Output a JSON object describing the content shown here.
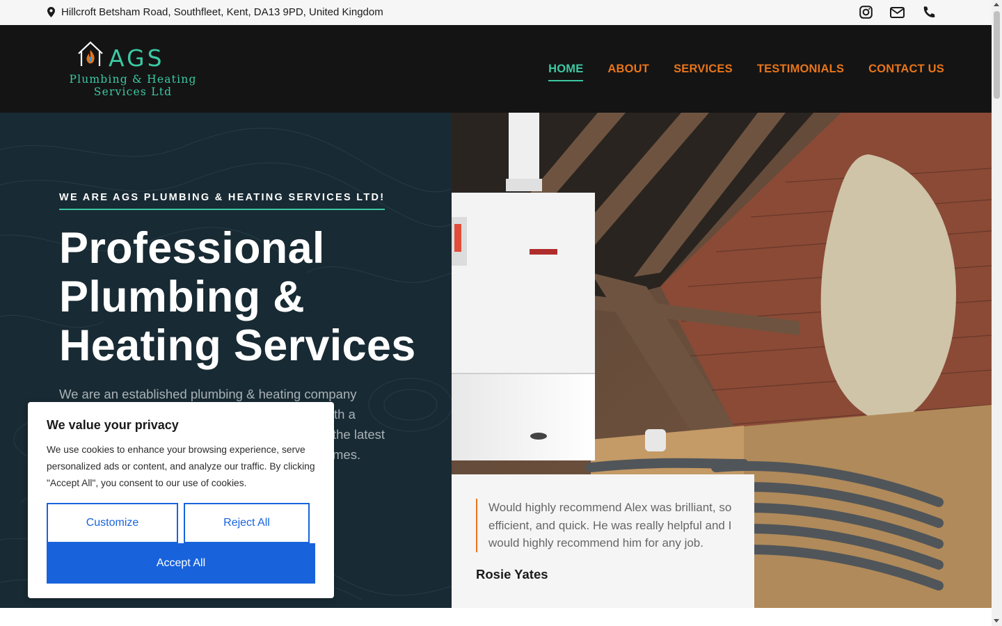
{
  "topbar": {
    "address": "Hillcroft Betsham Road, Southfleet, Kent, DA13 9PD, United Kingdom",
    "icons": [
      "location-pin-icon",
      "instagram-icon",
      "email-icon",
      "phone-icon"
    ]
  },
  "logo": {
    "name": "AGS",
    "line1": "Plumbing & Heating",
    "line2": "Services Ltd"
  },
  "nav": {
    "items": [
      {
        "label": "HOME",
        "active": true
      },
      {
        "label": "ABOUT",
        "active": false
      },
      {
        "label": "SERVICES",
        "active": false
      },
      {
        "label": "TESTIMONIALS",
        "active": false
      },
      {
        "label": "CONTACT US",
        "active": false
      }
    ]
  },
  "hero": {
    "eyebrow": "WE ARE AGS PLUMBING & HEATING SERVICES LTD!",
    "headline_line1": "Professional",
    "headline_line2": "Plumbing &",
    "headline_line3": "Heating Services",
    "lead_line1": "We are an established plumbing & heating company",
    "lead_line2": "th a",
    "lead_line3": "the latest",
    "lead_line4": "mes."
  },
  "testimonial": {
    "quote": "Would highly recommend Alex was brilliant, so efficient, and quick. He was really helpful and I would highly recommend him for any job.",
    "author": "Rosie Yates"
  },
  "cookie": {
    "title": "We value your privacy",
    "body": "We use cookies to enhance your browsing experience, serve personalized ads or content, and analyze our traffic. By clicking \"Accept All\", you consent to our use of cookies.",
    "customize_label": "Customize",
    "reject_label": "Reject All",
    "accept_label": "Accept All"
  },
  "colors": {
    "brand_teal": "#3bc9a3",
    "brand_orange": "#e8751a",
    "hero_bg": "#182a33",
    "header_bg": "#141414",
    "cookie_blue": "#1863dc"
  }
}
